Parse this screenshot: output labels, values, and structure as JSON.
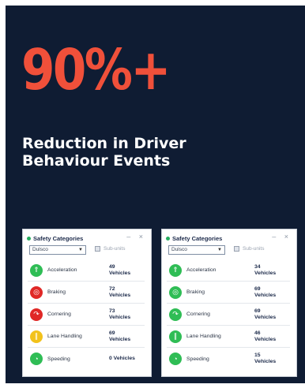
{
  "hero": {
    "stat": "90%+",
    "headline": "Reduction in Driver Behaviour Events"
  },
  "colors": {
    "background": "#0f1c33",
    "stat": "#f0503a",
    "good": "#2fbd55",
    "bad": "#e02826",
    "warn": "#f2c21b"
  },
  "panels": [
    {
      "title": "Safety Categories",
      "controls": "– ×",
      "select_value": "Dulsco",
      "subunits_label": "Sub-units",
      "rows": [
        {
          "label": "Acceleration",
          "count": "49",
          "unit": "Vehicles",
          "icon": "acceleration-icon",
          "status": "green"
        },
        {
          "label": "Braking",
          "count": "72",
          "unit": "Vehicles",
          "icon": "braking-icon",
          "status": "red"
        },
        {
          "label": "Cornering",
          "count": "73",
          "unit": "Vehicles",
          "icon": "cornering-icon",
          "status": "red"
        },
        {
          "label": "Lane Handling",
          "count": "69",
          "unit": "Vehicles",
          "icon": "lane-handling-icon",
          "status": "yellow"
        },
        {
          "label": "Speeding",
          "count": "0",
          "unit": "Vehicles",
          "icon": "speeding-icon",
          "status": "green"
        }
      ]
    },
    {
      "title": "Safety Categories",
      "controls": "– ×",
      "select_value": "Dulsco",
      "subunits_label": "Sub-units",
      "rows": [
        {
          "label": "Acceleration",
          "count": "34",
          "unit": "Vehicles",
          "icon": "acceleration-icon",
          "status": "green"
        },
        {
          "label": "Braking",
          "count": "69",
          "unit": "Vehicles",
          "icon": "braking-icon",
          "status": "green"
        },
        {
          "label": "Cornering",
          "count": "69",
          "unit": "Vehicles",
          "icon": "cornering-icon",
          "status": "green"
        },
        {
          "label": "Lane Handling",
          "count": "46",
          "unit": "Vehicles",
          "icon": "lane-handling-icon",
          "status": "green"
        },
        {
          "label": "Speeding",
          "count": "15",
          "unit": "Vehicles",
          "icon": "speeding-icon",
          "status": "green"
        }
      ]
    }
  ]
}
